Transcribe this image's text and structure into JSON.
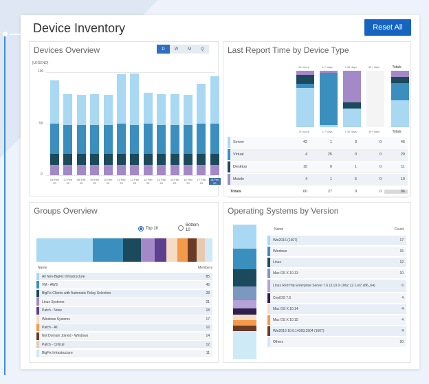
{
  "header": {
    "title": "Device Inventory",
    "reset_label": "Reset All"
  },
  "colors": {
    "accent": "#1565c0",
    "server": "#a9d8f2",
    "virtual": "#3b8fbf",
    "desktop": "#1b4a5c",
    "mobile": "#a489c9"
  },
  "devices_overview": {
    "title": "Devices Overview",
    "toggles": [
      "D",
      "W",
      "M",
      "Q"
    ],
    "active_toggle": "D",
    "legend_label": "[LEGEND]",
    "y_ticks": [
      "100",
      "50",
      "0"
    ],
    "selected_index": 12,
    "chart_data": {
      "type": "bar",
      "categories": [
        "06 Feb 20",
        "07 Feb 20",
        "08 Feb 20",
        "09 Feb 20",
        "10 Feb 20",
        "11 Feb 20",
        "12 Feb 20",
        "13 Feb 20",
        "14 Feb 20",
        "15 Feb 20",
        "16 Feb 20",
        "17 Feb 20",
        "18 Feb 20"
      ],
      "ylim": [
        0,
        100
      ],
      "series": [
        {
          "name": "Mobile",
          "values": [
            10,
            10,
            10,
            10,
            10,
            10,
            10,
            10,
            10,
            10,
            10,
            10,
            10
          ]
        },
        {
          "name": "Desktop",
          "values": [
            11,
            11,
            11,
            11,
            11,
            11,
            11,
            11,
            11,
            11,
            11,
            11,
            11
          ]
        },
        {
          "name": "Virtual",
          "values": [
            29,
            28,
            28,
            28,
            28,
            29,
            28,
            29,
            28,
            28,
            28,
            29,
            29
          ]
        },
        {
          "name": "Server",
          "values": [
            42,
            30,
            29,
            30,
            29,
            48,
            50,
            30,
            30,
            30,
            29,
            39,
            46
          ]
        }
      ]
    }
  },
  "last_report": {
    "title": "Last Report Time by Device Type",
    "columns": [
      "24 hours",
      "1-7 days",
      "7-30 days",
      "30+ days",
      "Totals"
    ],
    "rows": [
      {
        "name": "Server",
        "values": [
          "42",
          "1",
          "3",
          "0",
          "46"
        ]
      },
      {
        "name": "Virtual",
        "values": [
          "4",
          "25",
          "0",
          "0",
          "29"
        ]
      },
      {
        "name": "Desktop",
        "values": [
          "10",
          "0",
          "1",
          "0",
          "11"
        ]
      },
      {
        "name": "Mobile",
        "values": [
          "4",
          "1",
          "5",
          "0",
          "10"
        ]
      }
    ],
    "totals": {
      "name": "Totals",
      "values": [
        "60",
        "27",
        "9",
        "0",
        "96"
      ]
    }
  },
  "groups": {
    "title": "Groups Overview",
    "radio_top": "Top 10",
    "radio_bottom": "Bottom 10",
    "col_name": "Name",
    "col_members": "Members",
    "rows": [
      {
        "name": "All Non-BigFix Infrastructure",
        "value": "85"
      },
      {
        "name": "VM - AWS",
        "value": "45"
      },
      {
        "name": "BigFix Clients with Automatic Relay Selection",
        "value": "28"
      },
      {
        "name": "Linux Systems",
        "value": "21"
      },
      {
        "name": "Patch - None",
        "value": "18"
      },
      {
        "name": "Windows Systems",
        "value": "17"
      },
      {
        "name": "Patch - All",
        "value": "16"
      },
      {
        "name": "Not Domain Joined - Windows",
        "value": "14"
      },
      {
        "name": "Patch - Critical",
        "value": "12"
      },
      {
        "name": "BigFix Infrastructure",
        "value": "11"
      }
    ]
  },
  "os": {
    "title": "Operating Systems by Version",
    "col_name": "Name",
    "col_count": "Count",
    "rows": [
      {
        "name": "Win2016 (1607)",
        "value": "17"
      },
      {
        "name": "Windows",
        "value": "15"
      },
      {
        "name": "Linux",
        "value": "12"
      },
      {
        "name": "Mac OS X 10.13",
        "value": "10"
      },
      {
        "name": "Linux Red Hat Enterprise Server 7.6 (3.10.0-1062.12.1.el7.x86_64)",
        "value": "6"
      },
      {
        "name": "CentOS 7.5",
        "value": "4"
      },
      {
        "name": "Mac OS X 10.14",
        "value": "4"
      },
      {
        "name": "Mac OS X 10.15",
        "value": "4"
      },
      {
        "name": "Win2016 10.0.14393.3504 (1607)",
        "value": "4"
      },
      {
        "name": "Others",
        "value": "20"
      }
    ]
  }
}
